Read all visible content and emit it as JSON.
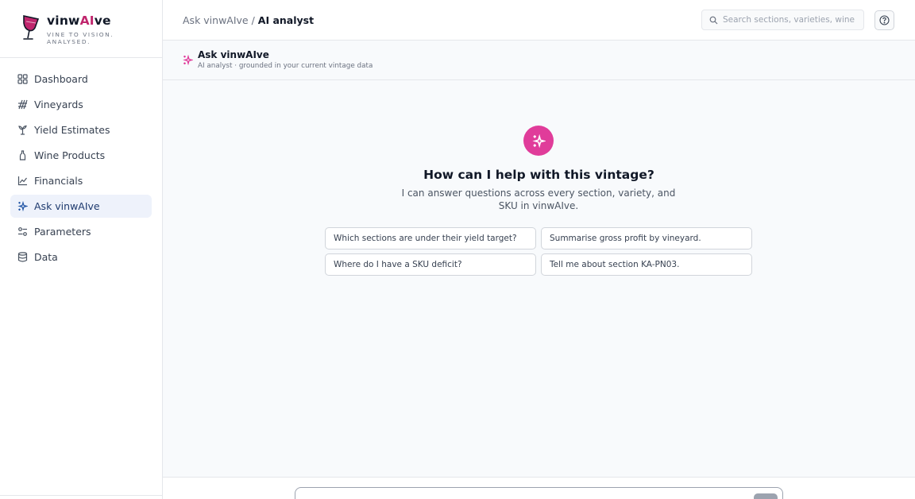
{
  "brand": {
    "name_prefix": "vinw",
    "name_ai": "AI",
    "name_suffix": "ve",
    "tagline": "VINE TO VISION. ANALYSED.",
    "accent_color": "#c0266d"
  },
  "sidebar": {
    "items": [
      {
        "label": "Dashboard",
        "icon": "grid-icon"
      },
      {
        "label": "Vineyards",
        "icon": "vineyard-icon"
      },
      {
        "label": "Yield Estimates",
        "icon": "grape-vine-icon"
      },
      {
        "label": "Wine Products",
        "icon": "bottle-icon"
      },
      {
        "label": "Financials",
        "icon": "line-chart-icon"
      },
      {
        "label": "Ask vinwAIve",
        "icon": "sparkles-icon",
        "active": true
      },
      {
        "label": "Parameters",
        "icon": "sliders-icon"
      },
      {
        "label": "Data",
        "icon": "database-icon"
      }
    ]
  },
  "header": {
    "breadcrumb_parent": "Ask vinwAIve",
    "breadcrumb_sep": " / ",
    "breadcrumb_current": "AI analyst",
    "search_placeholder": "Search sections, varieties, wine products…",
    "help_icon": "help-circle-icon"
  },
  "page": {
    "title": "Ask vinwAIve",
    "subtitle": "AI analyst · grounded in your current vintage data"
  },
  "chat": {
    "hero_title": "How can I help with this vintage?",
    "hero_subtitle": "I can answer questions across every section, variety, and SKU in vinwAIve.",
    "hero_color": "#e03c9a",
    "suggestions": [
      "Which sections are under their yield target?",
      "Summarise gross profit by vineyard.",
      "Where do I have a SKU deficit?",
      "Tell me about section KA-PN03."
    ]
  }
}
